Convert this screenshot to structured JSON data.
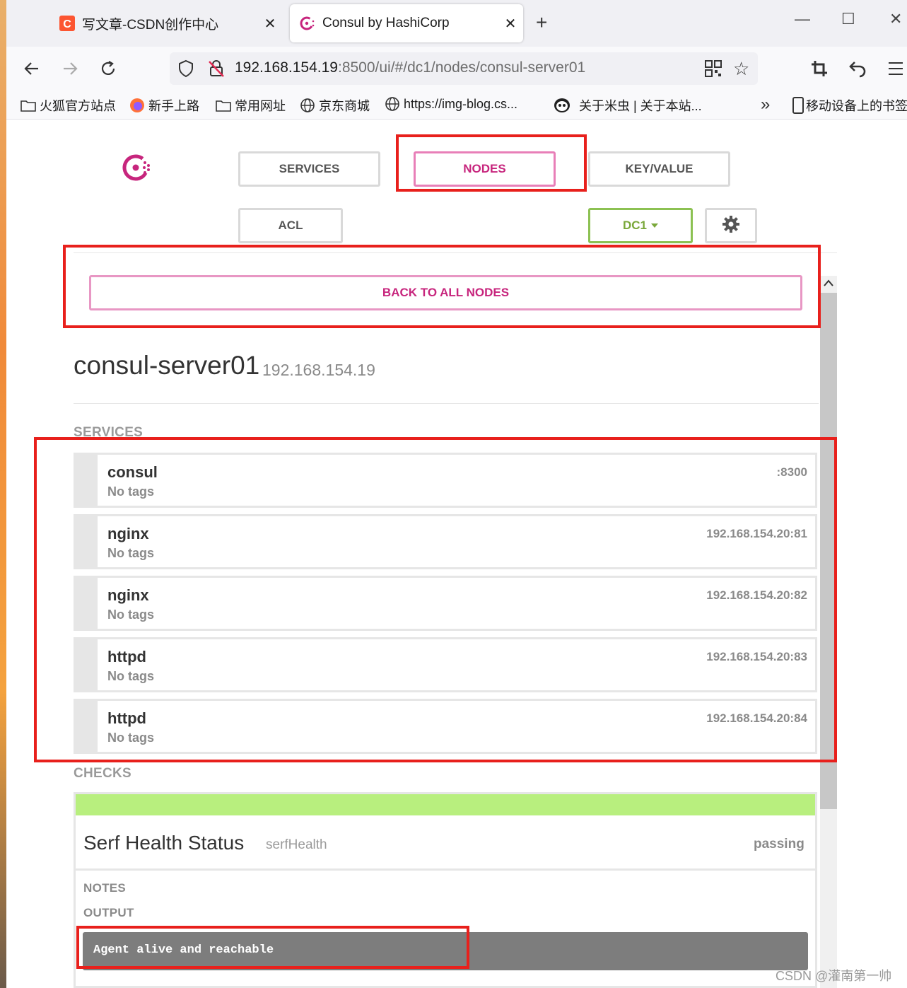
{
  "browser": {
    "tabs": [
      {
        "title": "写文章-CSDN创作中心",
        "favicon": "csdn-icon"
      },
      {
        "title": "Consul by HashiCorp",
        "favicon": "consul-icon",
        "active": true
      }
    ],
    "url_host": "192.168.154.19",
    "url_path": ":8500/ui/#/dc1/nodes/consul-server01",
    "bookmarks": [
      "火狐官方站点",
      "新手上路",
      "常用网址",
      "京东商城",
      "https://img-blog.cs...",
      "关于米虫 | 关于本站...",
      "移动设备上的书签"
    ]
  },
  "nav": {
    "services": "SERVICES",
    "nodes": "NODES",
    "keyvalue": "KEY/VALUE",
    "acl": "ACL",
    "datacenter": "DC1"
  },
  "back_button": "BACK TO ALL NODES",
  "node": {
    "name": "consul-server01",
    "address": "192.168.154.19"
  },
  "services_heading": "SERVICES",
  "services": [
    {
      "name": "consul",
      "tags": "No tags",
      "address": ":8300"
    },
    {
      "name": "nginx",
      "tags": "No tags",
      "address": "192.168.154.20:81"
    },
    {
      "name": "nginx",
      "tags": "No tags",
      "address": "192.168.154.20:82"
    },
    {
      "name": "httpd",
      "tags": "No tags",
      "address": "192.168.154.20:83"
    },
    {
      "name": "httpd",
      "tags": "No tags",
      "address": "192.168.154.20:84"
    }
  ],
  "checks_heading": "CHECKS",
  "check": {
    "name": "Serf Health Status",
    "id": "serfHealth",
    "status": "passing",
    "notes_label": "NOTES",
    "output_label": "OUTPUT",
    "output": "Agent alive and reachable"
  },
  "watermark": "CSDN @灌南第一帅",
  "colors": {
    "accent": "#c7257d",
    "passing": "#b8ef7e",
    "datacenter": "#7aa83a",
    "annotation": "#e8201c"
  }
}
